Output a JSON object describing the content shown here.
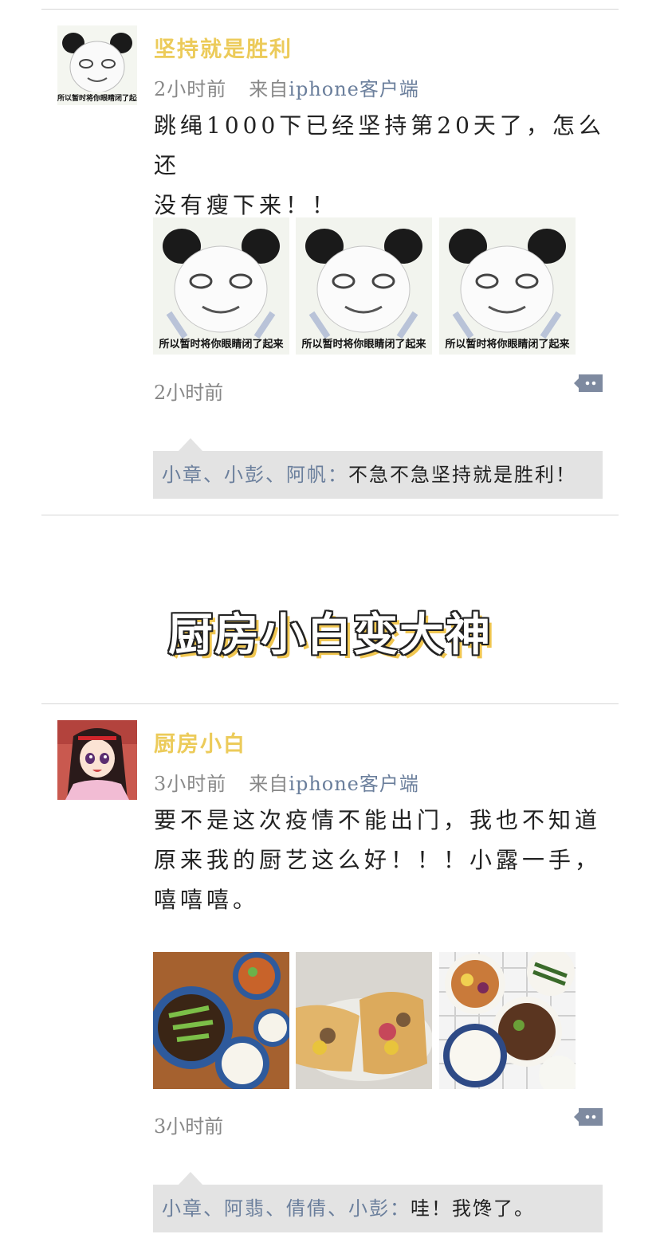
{
  "posts": [
    {
      "username": "坚持就是胜利",
      "time": "2小时前",
      "source_label": "来自",
      "source": "iphone客户端",
      "content_lines": [
        "跳绳1000下已经坚持第20天了，怎么还",
        "没有瘦下来！！"
      ],
      "avatar_caption": "所以暂时将你眼睛闭了起来",
      "photos": [
        {
          "caption": "所以暂时将你眼睛闭了起来"
        },
        {
          "caption": "所以暂时将你眼睛闭了起来"
        },
        {
          "caption": "所以暂时将你眼睛闭了起来"
        }
      ],
      "footer_time": "2小时前",
      "reply_names": "小章、小彭、阿帆：",
      "reply_text": "不急不急坚持就是胜利！"
    },
    {
      "username": "厨房小白",
      "time": "3小时前",
      "source_label": "来自",
      "source": "iphone客户端",
      "content_lines": [
        "要不是这次疫情不能出门，我也不知道",
        "原来我的厨艺这么好！！！小露一手，",
        "嘻嘻嘻。"
      ],
      "footer_time": "3小时前",
      "reply_names": "小章、阿翡、倩倩、小彭：",
      "reply_text": "哇！我馋了。"
    }
  ],
  "section_title": "厨房小白变大神",
  "icons": {
    "comment": "comment-bubble-icon"
  }
}
